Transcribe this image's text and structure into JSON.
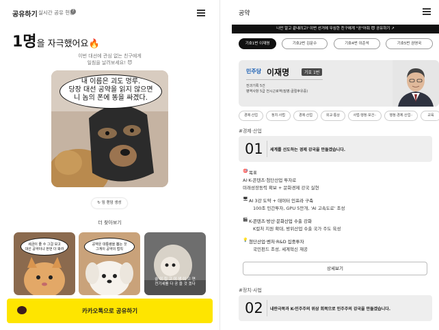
{
  "left": {
    "header": {
      "title": "공유하기",
      "subtitle": "실시간 공유 현황",
      "info_icon": "?"
    },
    "headline": {
      "count": "1명",
      "text": "을 자극했어요",
      "emoji": "🔥"
    },
    "description": [
      "이번 대선에 관심 없는 친구에게",
      "일침을 날려보세요! 😈"
    ],
    "main_meme": {
      "caption": [
        "내 이름은 괴도 멍루.",
        "당장 대선 공약을 읽지 않으면",
        "니 놈의 폰에 똥을 싸겠다."
      ]
    },
    "shuffle_label": "밈 랜덤 생성",
    "more_label": "더 찾아보기",
    "thumbnails": [
      {
        "caption": [
          "세금이 줄 수 그걸 보고",
          "대선 공약이냐 한번 더 봐라"
        ]
      },
      {
        "caption": [
          "공약은 대통령을 뽑는 것",
          "그게이 공약의 법칙"
        ]
      },
      {
        "caption": [
          "술 이 집 고 이 생 이 으 면",
          "전기세를 다 공 을 것 겠다"
        ]
      }
    ],
    "kakao_button": {
      "label": "카카오톡으로 공유하기"
    },
    "colors": {
      "kakao": "#fee500"
    }
  },
  "right": {
    "title": "공약",
    "banner": "나만 알고 끝내려고? 이번 선거에 무심한 친구에게 \"공\"어줘 😈 공유하기 ↗",
    "tabs": [
      "기호1번 이재명",
      "기호2번 김문수",
      "기호4번 이준석",
      "기호5번 권영국"
    ],
    "candidate": {
      "party": "민주당",
      "name": "이재명",
      "number": "기호 1번",
      "info": [
        "전과기록 5건",
        "병역사항 5급 전시근로역(질병:골절후유증)"
      ]
    },
    "categories": [
      "경제·산업",
      "정치·사법",
      "경제·산업",
      "외교·통상",
      "사법·행정·보건··",
      "행정·경제·산업··",
      "교육"
    ],
    "promises": [
      {
        "tag": "#경제·산업",
        "number": "01",
        "text": "세계를 선도하는 경제 강국을 만들겠습니다.",
        "items": [
          {
            "icon": "🎯",
            "title": "목표",
            "lines": [
              "AI·K-콘텐츠·첨단산업 투자로",
              "미래성장동력 확보 + 문화경제 강국 실현"
            ]
          },
          {
            "icon": "🖥",
            "title": "AI 3강 도약 + 데이터 인프라 구축",
            "lines": [
              "100조 민간투자, GPU 5만개, 'AI 고속도로' 조성"
            ]
          },
          {
            "icon": "🎬",
            "title": "K-콘텐츠·방산·문화산업 수출 강화",
            "lines": [
              "K컬처 지원 확대, 방위산업 수출 국가 주도 육성"
            ]
          },
          {
            "icon": "💡",
            "title": "첨단산업·벤처·R&D 집중투자",
            "lines": [
              "국민펀드 조성, 세계혁신 재공"
            ]
          }
        ],
        "detail_button": "상세보기"
      },
      {
        "tag": "#정치·사법",
        "number": "02",
        "text": "내란극복과 K-민주주의 위상 회복으로 민주주의 강국을 만들겠습니다."
      }
    ]
  }
}
